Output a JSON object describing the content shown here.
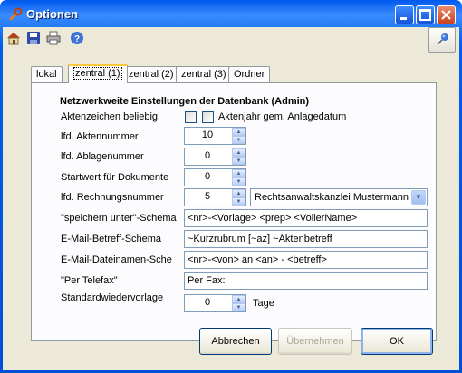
{
  "window": {
    "title": "Optionen"
  },
  "tabs": [
    "lokal",
    "zentral (1)",
    "zentral (2)",
    "zentral (3)",
    "Ordner"
  ],
  "panel": {
    "heading": "Netzwerkweite Einstellungen der Datenbank (Admin)",
    "aktenzeichen_label": "Aktenzeichen beliebig",
    "aktenjahr_label": "Aktenjahr gem. Anlagedatum",
    "lfd_aktennummer_label": "lfd. Aktennummer",
    "lfd_aktennummer_value": "10",
    "lfd_ablagenummer_label": "lfd. Ablagenummer",
    "lfd_ablagenummer_value": "0",
    "startwert_label": "Startwert für Dokumente",
    "startwert_value": "0",
    "lfd_rechnungsnummer_label": "lfd. Rechnungsnummer",
    "lfd_rechnungsnummer_value": "5",
    "kanzlei_select_value": "Rechtsanwaltskanzlei Mustermann",
    "speichern_label": "\"speichern unter\"-Schema",
    "speichern_value": "<nr>-<Vorlage> <prep> <VollerName>",
    "email_betreff_label": "E-Mail-Betreff-Schema",
    "email_betreff_value": "~Kurzrubrum [~az] ~Aktenbetreff",
    "email_datei_label": "E-Mail-Dateinamen-Sche",
    "email_datei_value": "<nr>-<von> an <an> - <betreff>",
    "telefax_label": "\"Per Telefax\"",
    "telefax_value": "Per Fax:",
    "standardwv_label": "Standardwiedervorlage",
    "standardwv_value": "0",
    "tage_label": "Tage"
  },
  "buttons": {
    "cancel": "Abbrechen",
    "apply": "Übernehmen",
    "ok": "OK"
  }
}
